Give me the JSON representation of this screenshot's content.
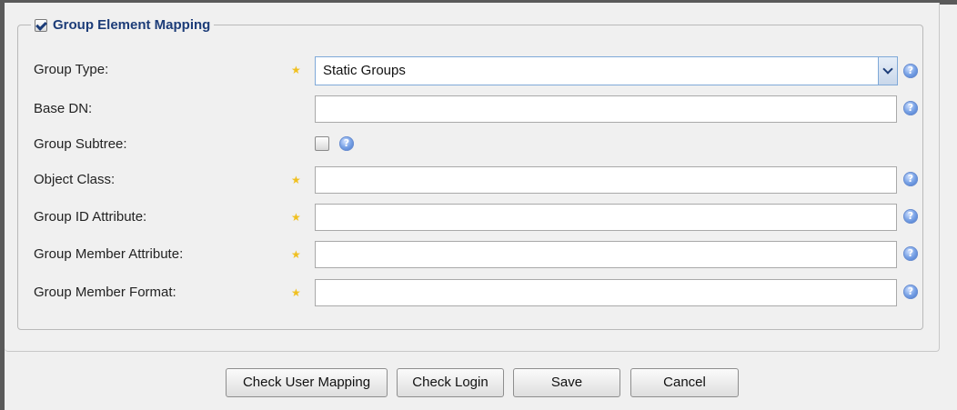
{
  "section": {
    "title": "Group Element Mapping",
    "enabled": true
  },
  "fields": {
    "group_type": {
      "label": "Group Type:",
      "required": true,
      "value": "Static Groups"
    },
    "base_dn": {
      "label": "Base DN:",
      "required": false,
      "value": ""
    },
    "group_subtree": {
      "label": "Group Subtree:",
      "checked": false
    },
    "object_class": {
      "label": "Object Class:",
      "required": true,
      "value": ""
    },
    "group_id_attribute": {
      "label": "Group ID Attribute:",
      "required": true,
      "value": ""
    },
    "group_member_attribute": {
      "label": "Group Member Attribute:",
      "required": true,
      "value": ""
    },
    "group_member_format": {
      "label": "Group Member Format:",
      "required": true,
      "value": ""
    }
  },
  "icons": {
    "required": "star-icon",
    "help": "help-icon",
    "dropdown": "chevron-down-icon"
  },
  "buttons": {
    "check_user_mapping": "Check User Mapping",
    "check_login": "Check Login",
    "save": "Save",
    "cancel": "Cancel"
  },
  "colors": {
    "legend_text": "#1c3c78",
    "required_star": "#f0c020",
    "help_icon": "#3c6fc8",
    "select_border": "#7fa9d8"
  }
}
